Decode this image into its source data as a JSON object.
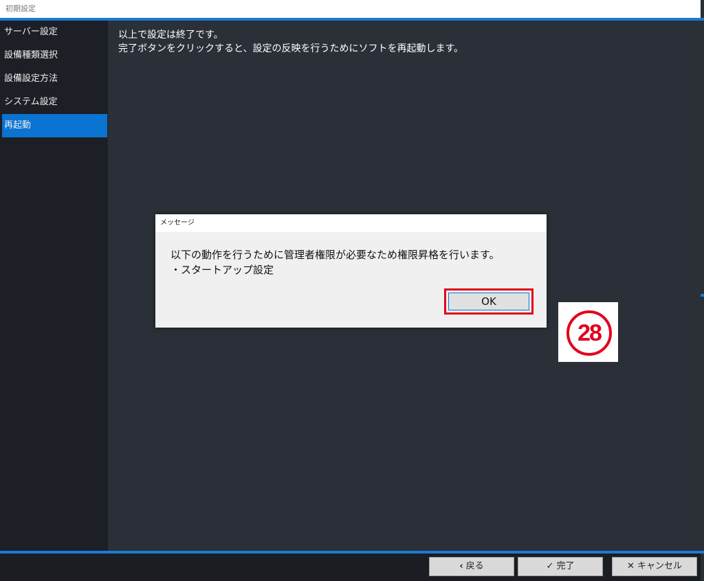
{
  "window": {
    "title": "初期設定"
  },
  "sidebar": {
    "items": [
      {
        "label": "サーバー設定"
      },
      {
        "label": "設備種類選択"
      },
      {
        "label": "設備設定方法"
      },
      {
        "label": "システム設定"
      },
      {
        "label": "再起動",
        "active": true
      }
    ]
  },
  "content": {
    "line1": "以上で設定は終了です。",
    "line2": "完了ボタンをクリックすると、設定の反映を行うためにソフトを再起動します。"
  },
  "dialog": {
    "title": "メッセージ",
    "message_line1": "以下の動作を行うために管理者権限が必要なため権限昇格を行います。",
    "message_line2": "・スタートアップ設定",
    "ok_label": "OK"
  },
  "footer": {
    "back_label": "戻る",
    "back_icon": "‹",
    "finish_label": "完了",
    "finish_icon": "✓",
    "cancel_label": "キャンセル",
    "cancel_icon": "✕"
  },
  "annotation": {
    "step_number": "28"
  },
  "colors": {
    "accent": "#1a7bd4",
    "active_item": "#0b73d1",
    "highlight": "#e3001b"
  }
}
